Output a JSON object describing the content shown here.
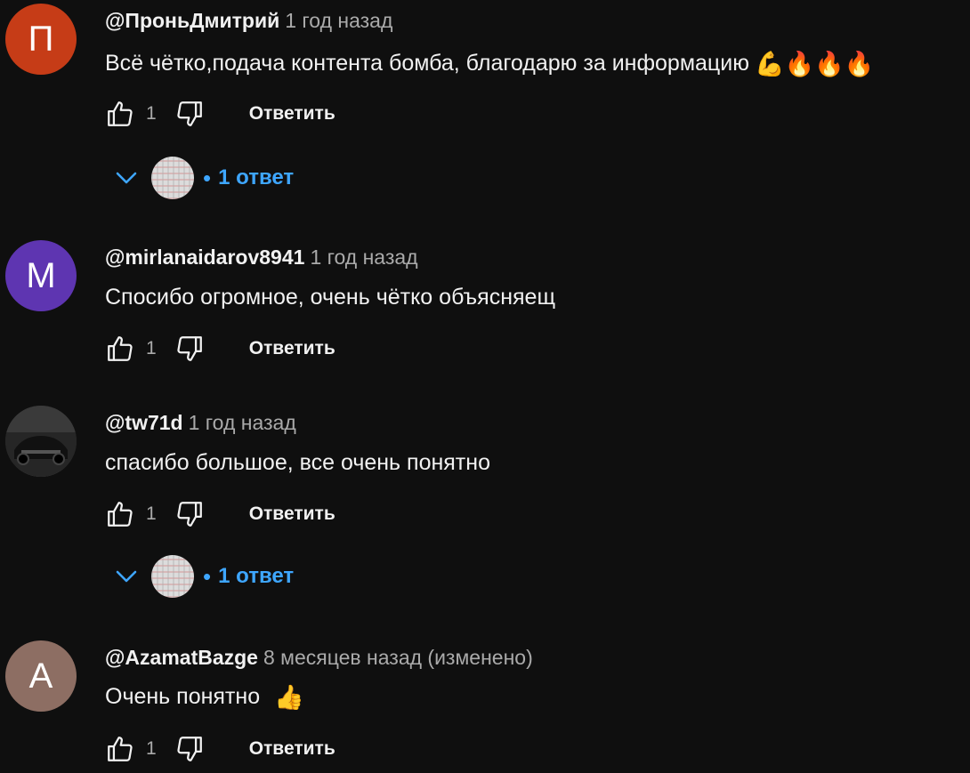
{
  "comments": [
    {
      "avatar_letter": "П",
      "avatar_color": "#c63c17",
      "author": "@ПроньДмитрий",
      "time": "1 год назад",
      "text": "Всё чётко,подача контента бомба, благодарю за информацию",
      "emojis": "💪🔥🔥🔥",
      "likes": "1",
      "reply_label": "Ответить",
      "replies_label": "1 ответ"
    },
    {
      "avatar_letter": "M",
      "avatar_color": "#5e35b1",
      "author": "@mirlanaidarov8941",
      "time": "1 год назад",
      "text": "Спосибо огромное, очень чётко объясняещ",
      "likes": "1",
      "reply_label": "Ответить"
    },
    {
      "avatar_letter": "",
      "avatar_color": "#2a2a2a",
      "author": "@tw71d",
      "time": "1 год назад",
      "text": "спасибо большое, все очень понятно",
      "likes": "1",
      "reply_label": "Ответить",
      "replies_label": "1 ответ"
    },
    {
      "avatar_letter": "A",
      "avatar_color": "#8d6e63",
      "author": "@AzamatBazge",
      "time": "8 месяцев назад (изменено)",
      "text": "Очень понятно",
      "emojis": "👍",
      "likes": "1",
      "reply_label": "Ответить"
    }
  ],
  "icons": {
    "like": "thumb-up-icon",
    "dislike": "thumb-down-icon",
    "expand": "chevron-down-icon"
  },
  "colors": {
    "background": "#0f0f0f",
    "link_blue": "#3ea6ff",
    "muted": "#aaaaaa"
  }
}
